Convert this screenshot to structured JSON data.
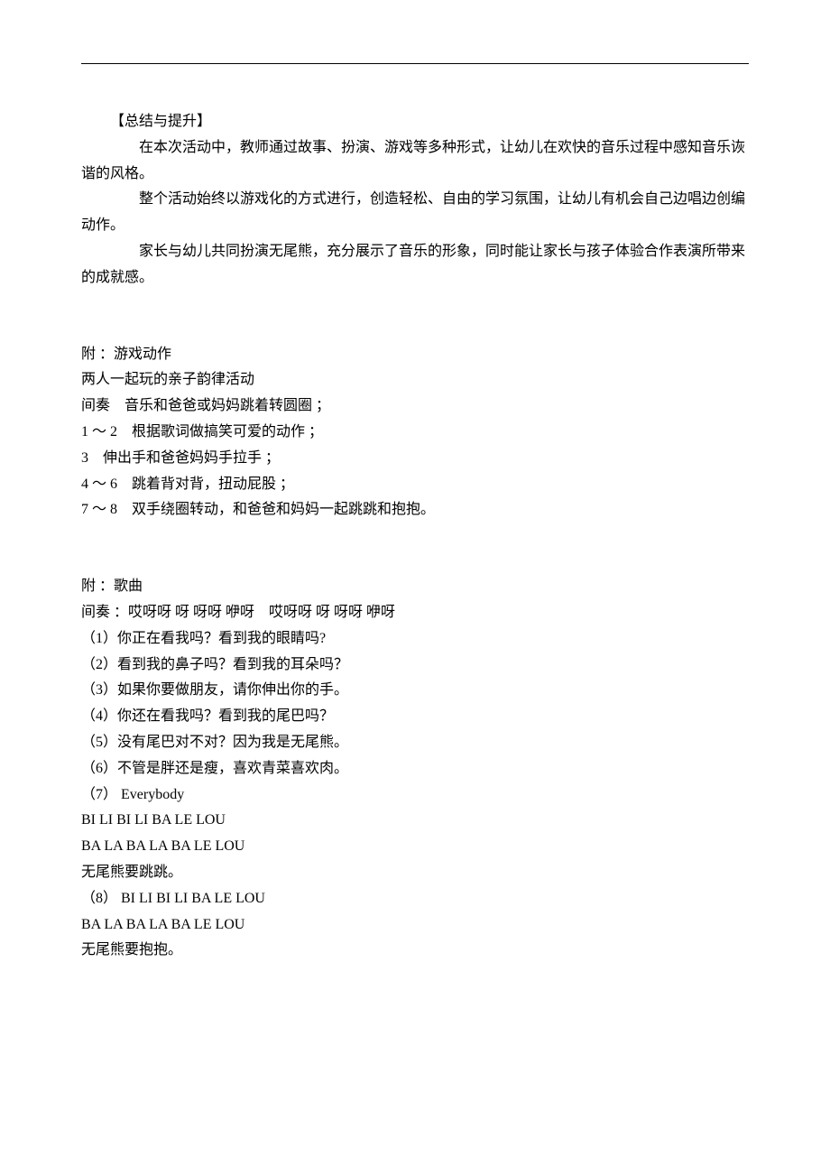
{
  "section_summary": {
    "heading": "【总结与提升】",
    "para1": "在本次活动中，教师通过故事、扮演、游戏等多种形式，让幼儿在欢快的音乐过程中感知音乐诙谐的风格。",
    "para2": "整个活动始终以游戏化的方式进行，创造轻松、自由的学习氛围，让幼儿有机会自己边唱边创编动作。",
    "para3": "家长与幼儿共同扮演无尾熊，充分展示了音乐的形象，同时能让家长与孩子体验合作表演所带来的成就感。"
  },
  "section_actions": {
    "title": "附 ：游戏动作",
    "subtitle": "两人一起玩的亲子韵律活动",
    "lines": {
      "l0": "间奏　音乐和爸爸或妈妈跳着转圆圈 ；",
      "l1": "1 ～ 2　根据歌词做搞笑可爱的动作 ；",
      "l2": "3　伸出手和爸爸妈妈手拉手 ；",
      "l3": "4 ～ 6　跳着背对背，扭动屁股 ；",
      "l4": "7 ～ 8　双手绕圈转动，和爸爸和妈妈一起跳跳和抱抱。"
    }
  },
  "section_song": {
    "title": "附 ：歌曲",
    "lines": {
      "l0": "间奏 ：哎呀呀 呀 呀呀 咿呀　哎呀呀 呀 呀呀 咿呀",
      "l1": "（1）你正在看我吗？看到我的眼睛吗?",
      "l2": "（2）看到我的鼻子吗？看到我的耳朵吗？",
      "l3": "（3）如果你要做朋友，请你伸出你的手。",
      "l4": "（4）你还在看我吗？看到我的尾巴吗？",
      "l5": "（5）没有尾巴对不对？因为我是无尾熊。",
      "l6": "（6）不管是胖还是瘦，喜欢青菜喜欢肉。",
      "l7": "（7）  Everybody",
      "l8": "BI LI BI LI BA LE LOU",
      "l9": "BA LA BA LA BA LE LOU",
      "l10": "无尾熊要跳跳。",
      "l11": "（8）  BI LI BI LI BA LE LOU",
      "l12": "BA LA BA LA BA LE LOU",
      "l13": "无尾熊要抱抱。"
    }
  }
}
